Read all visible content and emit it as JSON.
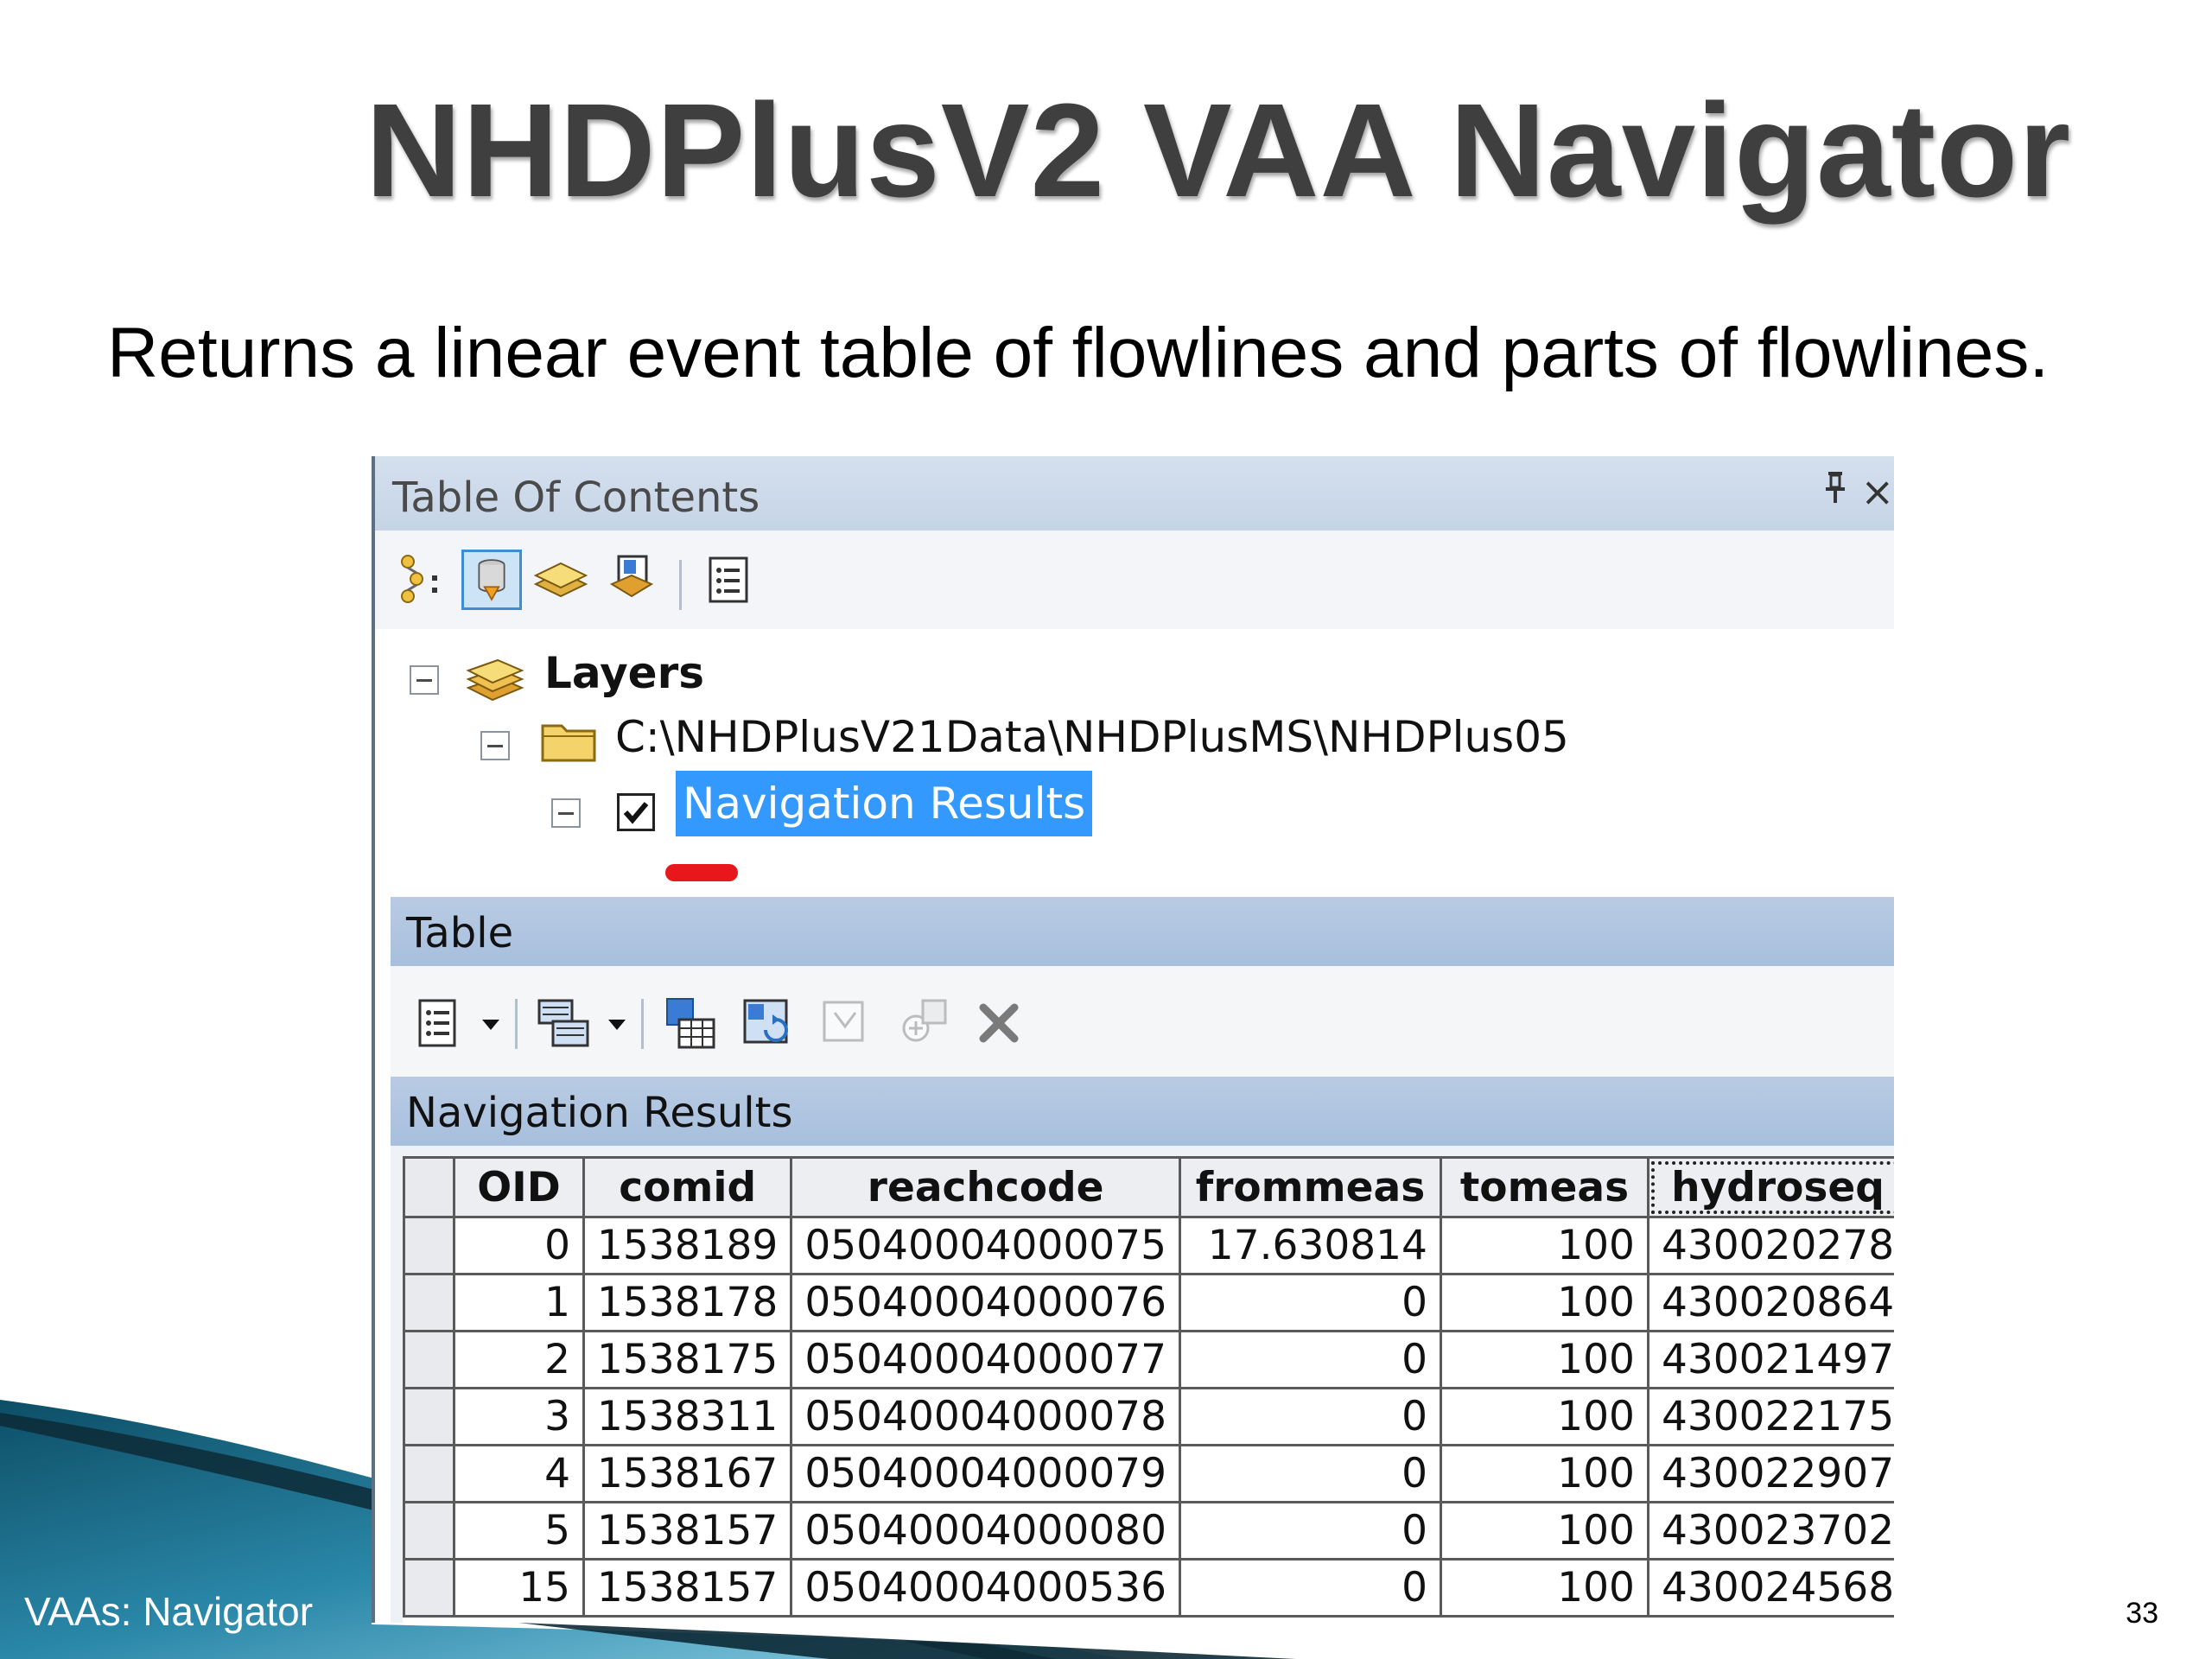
{
  "slide": {
    "title": "NHDPlusV2 VAA Navigator",
    "subtitle": "Returns a linear event table of flowlines and parts of flowlines.",
    "footer_label": "VAAs: Navigator",
    "page_number": "33"
  },
  "toc": {
    "title": "Table Of Contents",
    "pin_glyph": "⫧",
    "close_glyph": "×",
    "toolbar_icons": [
      "list-by-drawing-order-icon",
      "list-by-source-icon",
      "list-by-visibility-icon",
      "list-by-selection-icon",
      "options-icon"
    ],
    "tree": {
      "root": "Layers",
      "folder": "C:\\NHDPlusV21Data\\NHDPlusMS\\NHDPlus05",
      "layer": "Navigation Results",
      "layer_checked": true
    }
  },
  "table_window": {
    "title": "Table",
    "toolbar_icons": [
      "table-options-icon",
      "related-tables-icon",
      "select-by-attributes-icon",
      "switch-selection-icon",
      "clear-selection-icon",
      "zoom-to-selected-icon",
      "delete-selected-icon"
    ],
    "table_name": "Navigation Results",
    "columns": [
      "OID",
      "comid",
      "reachcode",
      "frommeas",
      "tomeas",
      "hydroseq"
    ],
    "active_column": "hydroseq",
    "rows": [
      [
        "0",
        "1538189",
        "05040004000075",
        "17.630814",
        "100",
        "430020278"
      ],
      [
        "1",
        "1538178",
        "05040004000076",
        "0",
        "100",
        "430020864"
      ],
      [
        "2",
        "1538175",
        "05040004000077",
        "0",
        "100",
        "430021497"
      ],
      [
        "3",
        "1538311",
        "05040004000078",
        "0",
        "100",
        "430022175"
      ],
      [
        "4",
        "1538167",
        "05040004000079",
        "0",
        "100",
        "430022907"
      ],
      [
        "5",
        "1538157",
        "05040004000080",
        "0",
        "100",
        "430023702"
      ],
      [
        "15",
        "1538157",
        "05040004000536",
        "0",
        "100",
        "430024568"
      ]
    ]
  },
  "colors": {
    "title": "#3f3f3f",
    "selection": "#3399ff",
    "panel_header": "#a7bfdd",
    "red_mark": "#e8171c",
    "wave_dark": "#0f4f66",
    "wave_light": "#5fb5d3"
  }
}
